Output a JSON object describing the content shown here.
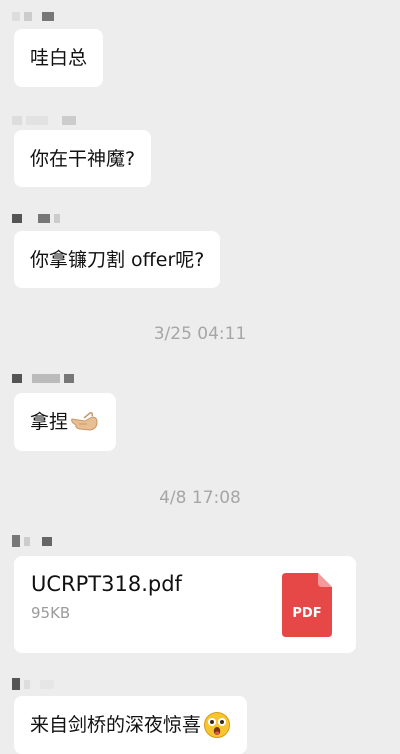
{
  "messages": [
    {
      "text": "哇白总"
    },
    {
      "text": "你在干神魔?"
    },
    {
      "text": "你拿镰刀割 offer呢?"
    },
    {
      "text": "拿捏",
      "emoji": "pinching-hand-icon"
    },
    {
      "text": "来自剑桥的深夜惊喜",
      "emoji": "astonished-face-icon"
    }
  ],
  "timestamps": [
    "3/25 04:11",
    "4/8 17:08"
  ],
  "file": {
    "name": "UCRPT318.pdf",
    "size": "95KB",
    "type_label": "PDF",
    "icon_color": "#e64848"
  },
  "colors": {
    "background": "#ededed",
    "bubble": "#ffffff",
    "timestamp_text": "#a6a6a6"
  }
}
